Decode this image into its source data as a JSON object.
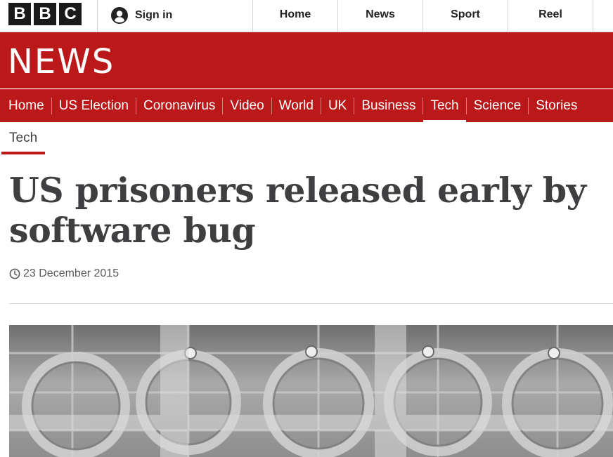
{
  "brand": {
    "letters": [
      "B",
      "B",
      "C"
    ],
    "news_wordmark": "NEWS",
    "accent_color": "#bb1919"
  },
  "topbar": {
    "signin_label": "Sign in",
    "signin_icon": "user-icon",
    "nav": [
      {
        "label": "Home"
      },
      {
        "label": "News"
      },
      {
        "label": "Sport"
      },
      {
        "label": "Reel"
      }
    ]
  },
  "section_nav": {
    "items": [
      {
        "label": "Home"
      },
      {
        "label": "US Election"
      },
      {
        "label": "Coronavirus"
      },
      {
        "label": "Video"
      },
      {
        "label": "World"
      },
      {
        "label": "UK"
      },
      {
        "label": "Business"
      },
      {
        "label": "Tech"
      },
      {
        "label": "Science"
      },
      {
        "label": "Stories"
      }
    ],
    "active": "Tech"
  },
  "article": {
    "category": "Tech",
    "headline": "US prisoners released early by software bug",
    "date_icon": "clock-icon",
    "date": "23 December 2015",
    "image_subject": "handcuffs hanging on a wire rack"
  }
}
